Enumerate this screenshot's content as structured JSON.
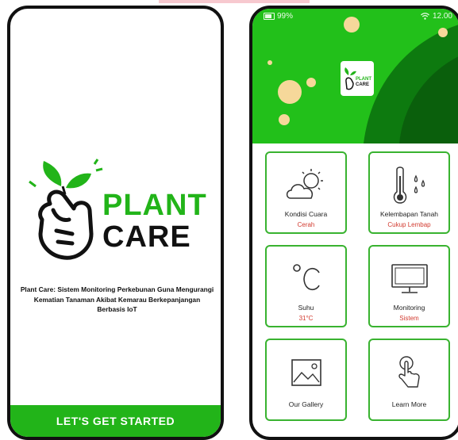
{
  "splash": {
    "brand_line1": "PLANT",
    "brand_line2": "CARE",
    "description": "Plant Care: Sistem Monitoring Perkebunan Guna Mengurangi Kematian Tanaman Akibat Kemarau Berkepanjangan Berbasis IoT",
    "cta_label": "LET'S GET STARTED"
  },
  "dashboard": {
    "status_bar": {
      "battery": "99%",
      "time": "12.00"
    },
    "logo_line1": "PLANT",
    "logo_line2": "CARE",
    "cards": [
      {
        "title": "Kondisi Cuara",
        "subtitle": "Cerah",
        "icon": "weather-sun-cloud-icon"
      },
      {
        "title": "Kelembapan Tanah",
        "subtitle": "Cukup Lembap",
        "icon": "thermometer-droplets-icon"
      },
      {
        "title": "Suhu",
        "subtitle": "31°C",
        "icon": "celsius-icon"
      },
      {
        "title": "Monitoring",
        "subtitle": "Sistem",
        "icon": "monitor-icon"
      },
      {
        "title": "Our Gallery",
        "icon": "gallery-icon"
      },
      {
        "title": "Learn More",
        "icon": "tap-hand-icon"
      }
    ]
  },
  "colors": {
    "accent": "#22b419",
    "header_green": "#22c01a",
    "dark_green": "#0d7a0f",
    "subtitle_red": "#d23a2f",
    "bubble_yellow": "#f6d89a"
  }
}
